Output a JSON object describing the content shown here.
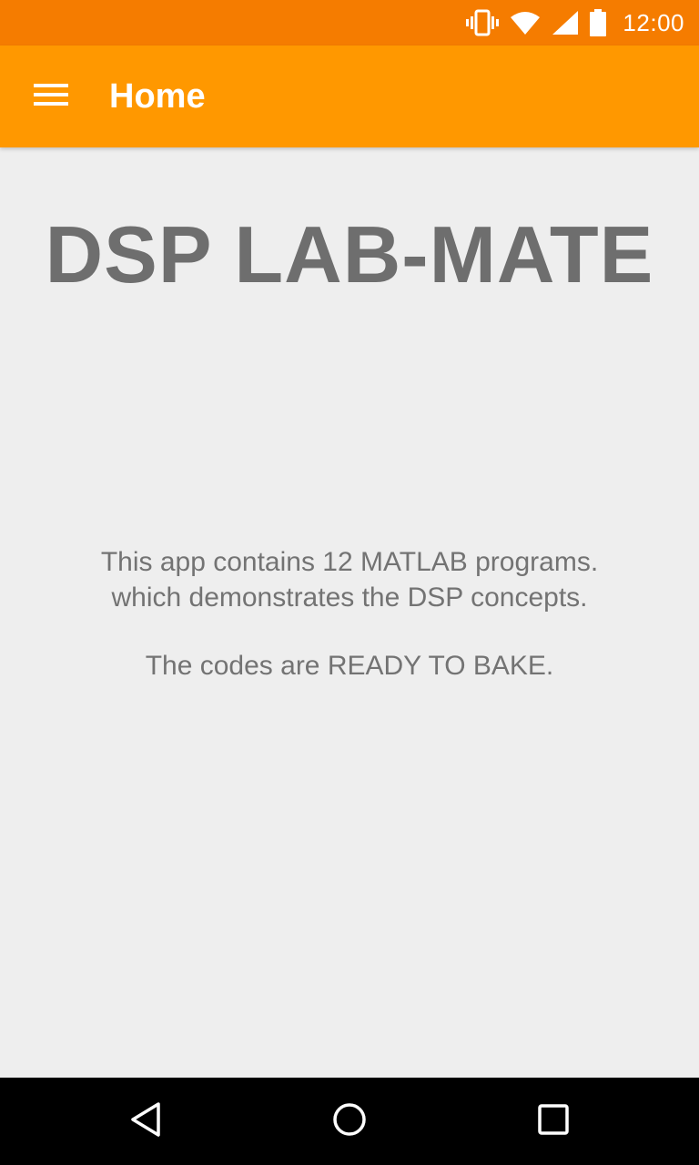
{
  "status_bar": {
    "time": "12:00",
    "icons": [
      "vibrate-icon",
      "wifi-icon",
      "signal-icon",
      "battery-icon"
    ],
    "color": "#f57c00"
  },
  "app_bar": {
    "title": "Home",
    "menu_icon": "menu-icon",
    "color": "#ff9800"
  },
  "content": {
    "headline": "DSP LAB-MATE",
    "description_line1": "This app contains 12 MATLAB programs.",
    "description_line2": "which demonstrates the DSP concepts.",
    "description_line3": "The codes are READY TO BAKE."
  },
  "nav_bar": {
    "buttons": [
      "back-icon",
      "home-icon",
      "recents-icon"
    ]
  }
}
